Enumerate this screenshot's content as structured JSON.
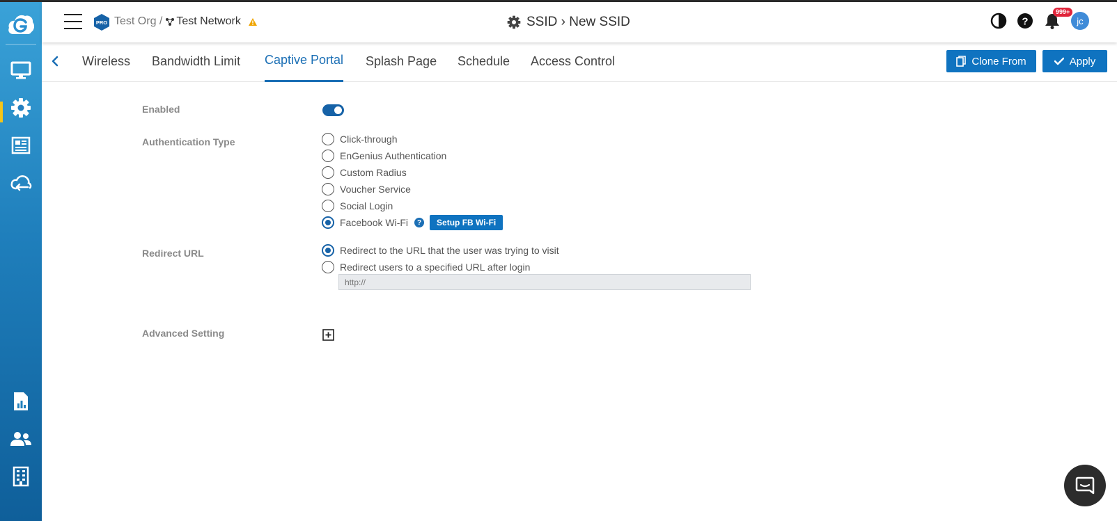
{
  "header": {
    "breadcrumb_org": "Test Org /",
    "breadcrumb_network": "Test Network",
    "page_title": "SSID › New SSID",
    "notification_count": "999+",
    "avatar_initials": "jc",
    "pro_badge": "PRO"
  },
  "tabs": [
    {
      "label": "Wireless"
    },
    {
      "label": "Bandwidth Limit"
    },
    {
      "label": "Captive Portal",
      "active": true
    },
    {
      "label": "Splash Page"
    },
    {
      "label": "Schedule"
    },
    {
      "label": "Access Control"
    }
  ],
  "actions": {
    "clone_label": "Clone From",
    "apply_label": "Apply"
  },
  "form": {
    "enabled_label": "Enabled",
    "enabled": true,
    "auth_label": "Authentication Type",
    "auth_options": [
      "Click-through",
      "EnGenius Authentication",
      "Custom Radius",
      "Voucher Service",
      "Social Login",
      "Facebook Wi-Fi"
    ],
    "auth_selected": "Facebook Wi-Fi",
    "setup_fb_label": "Setup FB Wi-Fi",
    "redirect_label": "Redirect URL",
    "redirect_options": [
      "Redirect to the URL that the user was trying to visit",
      "Redirect users to a specified URL after login"
    ],
    "redirect_selected": "Redirect to the URL that the user was trying to visit",
    "redirect_url_placeholder": "http://",
    "advanced_label": "Advanced Setting"
  },
  "colors": {
    "accent": "#1b6fb5",
    "button": "#0f73c0",
    "badge": "#e0243a",
    "sidebar_active": "#f5c518",
    "warning": "#f0a500"
  },
  "icons": {
    "sidebar": [
      "monitor-icon",
      "gear-icon",
      "newspaper-icon",
      "cloud-icon",
      "report-icon",
      "users-icon",
      "building-icon"
    ],
    "header": [
      "menu-icon",
      "warning-icon",
      "gear-icon",
      "contrast-icon",
      "help-icon",
      "bell-icon"
    ]
  }
}
